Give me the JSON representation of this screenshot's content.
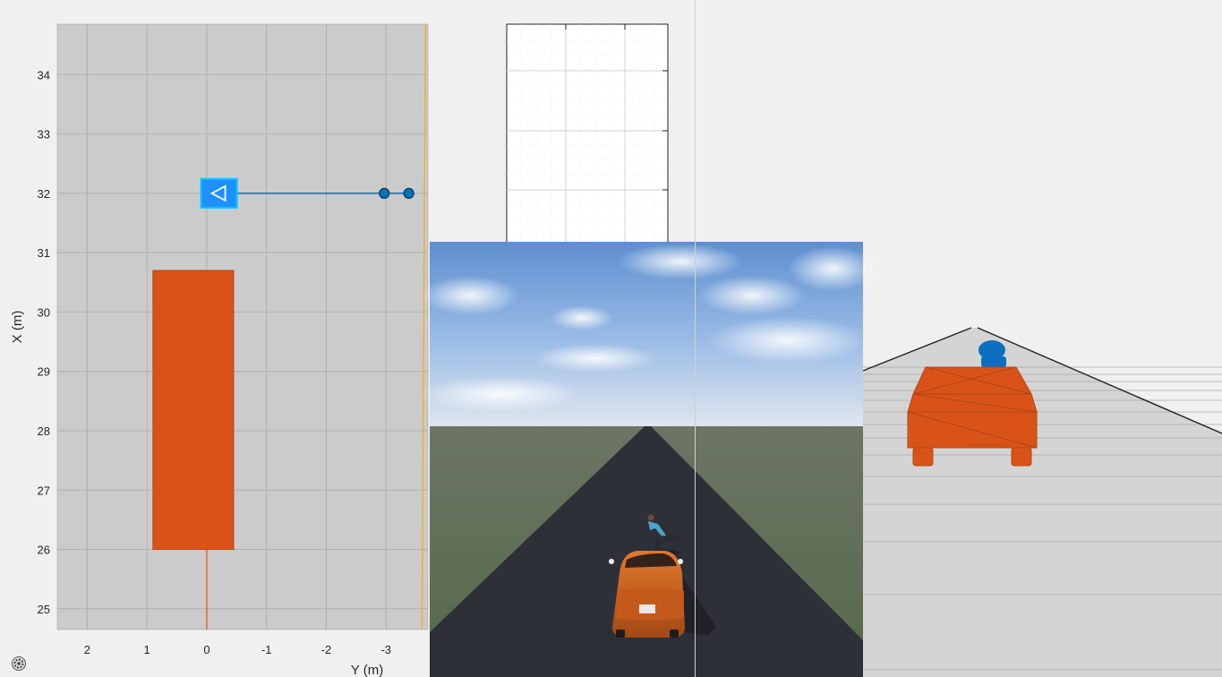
{
  "colors": {
    "figure_bg": "#f0f0f0",
    "axes_bg": "#cbcbcb",
    "grid": "#b0b0b0",
    "vehicle": "#d95319",
    "sensor": "#0072bd",
    "target_fill": "#1e90ff",
    "target_edge": "#00c8ff",
    "lane_line": "#f0b030"
  },
  "bird_eye_plot": {
    "xlabel": "Y (m)",
    "ylabel": "X (m)",
    "x_ticks": [
      "2",
      "1",
      "0",
      "-1",
      "-2",
      "-3"
    ],
    "y_ticks": [
      "25",
      "26",
      "27",
      "28",
      "29",
      "30",
      "31",
      "32",
      "33",
      "34"
    ]
  },
  "chart_data": {
    "type": "scatter",
    "xlabel": "Y (m)",
    "ylabel": "X (m)",
    "xlim": [
      2.5,
      -3.7
    ],
    "ylim": [
      24.65,
      34.85
    ],
    "x_reversed": true,
    "grid": true,
    "ego_vehicle": {
      "y_left": 0.9,
      "y_right": -0.45,
      "x_rear": 26.0,
      "x_front": 30.7
    },
    "ego_centerline": {
      "y": 0,
      "x_from": 24.65,
      "x_to": 26.0
    },
    "track": {
      "marker": "triangle-left",
      "y": -0.22,
      "x": 32.0
    },
    "detections": [
      {
        "y": -2.97,
        "x": 32.0
      },
      {
        "y": -3.38,
        "x": 32.0
      }
    ],
    "lane_boundary": {
      "x_from": 34.85,
      "x_to": 24.65,
      "y_from": -3.66,
      "y_to": -3.6
    }
  },
  "icons": {
    "figure_tools": "gear-icon"
  }
}
